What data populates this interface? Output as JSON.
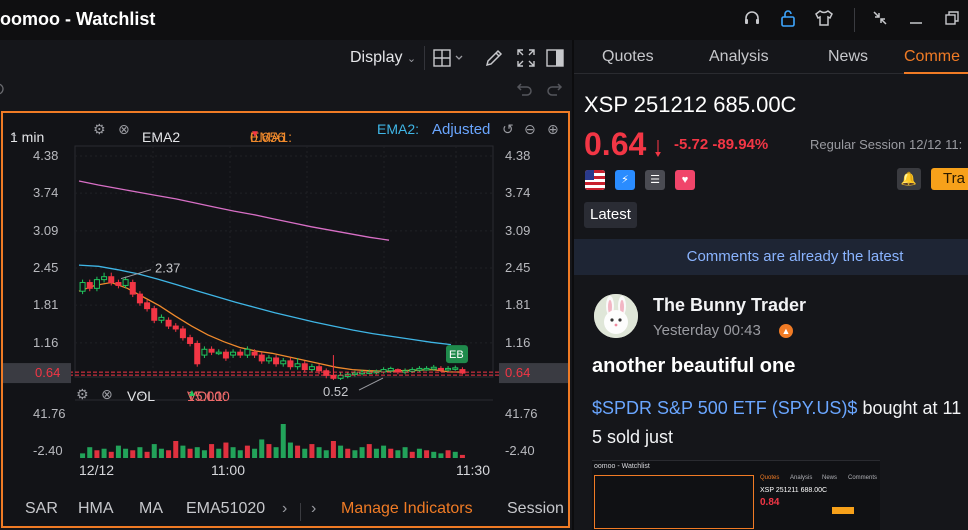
{
  "window": {
    "title": "oomoo - Watchlist",
    "icons": [
      "headset-icon",
      "lock-icon",
      "shirt-icon",
      "collapse-icon",
      "minimize-icon",
      "restore-icon"
    ]
  },
  "toolbar": {
    "display_label": "Display",
    "icons": [
      "layout-grid-icon",
      "pencil-icon",
      "fullscreen-icon",
      "panel-icon",
      "undo-icon",
      "redo-icon"
    ]
  },
  "chart_header": {
    "period": "1 min",
    "indicator": "EMA2",
    "ema1_label": "EMA1:",
    "ema1_value": "0.656",
    "ema2_label": "EMA2:",
    "ema2_value": "Adjusted"
  },
  "volume_header": {
    "indicator": "VOL",
    "vol1_label": "VOL1:",
    "vol1_value": "15.000"
  },
  "indicator_bar": {
    "items": [
      "SAR",
      "HMA",
      "MA",
      "EMA51020"
    ],
    "manage_label": "Manage Indicators",
    "session_label": "Session"
  },
  "chart_data": [
    {
      "type": "candlestick",
      "title": "",
      "y_ticks": [
        "4.38",
        "3.74",
        "3.09",
        "2.45",
        "1.81",
        "1.16",
        "0.64"
      ],
      "ylim": [
        0.3,
        4.5
      ],
      "x_ticks": [
        "12/12",
        "11:00",
        "11:30"
      ],
      "current_price": "0.64",
      "annotations": [
        "2.37",
        "0.52"
      ],
      "marker_label": "EB",
      "candles": [
        [
          2.05,
          2.2,
          2.25,
          2.0
        ],
        [
          2.2,
          2.1,
          2.25,
          2.05
        ],
        [
          2.1,
          2.25,
          2.3,
          2.05
        ],
        [
          2.25,
          2.3,
          2.37,
          2.2
        ],
        [
          2.3,
          2.2,
          2.37,
          2.15
        ],
        [
          2.2,
          2.15,
          2.25,
          2.1
        ],
        [
          2.15,
          2.25,
          2.3,
          2.1
        ],
        [
          2.2,
          2.0,
          2.25,
          1.95
        ],
        [
          2.0,
          1.85,
          2.05,
          1.8
        ],
        [
          1.85,
          1.75,
          1.9,
          1.7
        ],
        [
          1.75,
          1.55,
          1.8,
          1.5
        ],
        [
          1.55,
          1.6,
          1.65,
          1.5
        ],
        [
          1.55,
          1.45,
          1.6,
          1.4
        ],
        [
          1.45,
          1.4,
          1.5,
          1.35
        ],
        [
          1.4,
          1.25,
          1.45,
          1.2
        ],
        [
          1.25,
          1.15,
          1.3,
          1.1
        ],
        [
          1.15,
          0.8,
          1.2,
          0.75
        ],
        [
          0.95,
          1.05,
          1.1,
          0.9
        ],
        [
          1.05,
          1.0,
          1.1,
          0.95
        ],
        [
          1.0,
          1.0,
          1.05,
          0.95
        ],
        [
          1.0,
          0.9,
          1.05,
          0.85
        ],
        [
          0.95,
          1.0,
          1.05,
          0.9
        ],
        [
          1.0,
          0.95,
          1.05,
          0.9
        ],
        [
          0.95,
          1.05,
          1.1,
          0.9
        ],
        [
          1.0,
          0.95,
          1.05,
          0.9
        ],
        [
          0.95,
          0.85,
          1.0,
          0.8
        ],
        [
          0.85,
          0.9,
          0.95,
          0.8
        ],
        [
          0.9,
          0.8,
          0.95,
          0.75
        ],
        [
          0.8,
          0.85,
          0.9,
          0.75
        ],
        [
          0.85,
          0.75,
          0.9,
          0.7
        ],
        [
          0.75,
          0.8,
          0.9,
          0.7
        ],
        [
          0.8,
          0.7,
          0.85,
          0.65
        ],
        [
          0.7,
          0.75,
          0.8,
          0.65
        ],
        [
          0.75,
          0.68,
          0.8,
          0.62
        ],
        [
          0.68,
          0.6,
          0.72,
          0.55
        ],
        [
          0.6,
          0.55,
          0.95,
          0.52
        ],
        [
          0.55,
          0.6,
          0.65,
          0.52
        ],
        [
          0.58,
          0.62,
          0.66,
          0.55
        ],
        [
          0.62,
          0.64,
          0.68,
          0.58
        ],
        [
          0.63,
          0.66,
          0.7,
          0.6
        ],
        [
          0.64,
          0.66,
          0.7,
          0.62
        ],
        [
          0.65,
          0.67,
          0.7,
          0.62
        ],
        [
          0.66,
          0.7,
          0.74,
          0.63
        ],
        [
          0.68,
          0.72,
          0.75,
          0.64
        ],
        [
          0.7,
          0.66,
          0.72,
          0.62
        ],
        [
          0.66,
          0.68,
          0.72,
          0.62
        ],
        [
          0.67,
          0.7,
          0.74,
          0.64
        ],
        [
          0.69,
          0.72,
          0.76,
          0.66
        ],
        [
          0.7,
          0.72,
          0.76,
          0.68
        ],
        [
          0.71,
          0.74,
          0.78,
          0.68
        ],
        [
          0.72,
          0.7,
          0.76,
          0.66
        ],
        [
          0.7,
          0.72,
          0.76,
          0.66
        ],
        [
          0.71,
          0.73,
          0.77,
          0.68
        ],
        [
          0.7,
          0.64,
          0.74,
          0.62
        ]
      ],
      "series": [
        {
          "name": "EMA1",
          "color": "#f08a2c",
          "values": [
            2.05,
            2.15,
            2.2,
            2.1,
            1.95,
            1.8,
            1.62,
            1.45,
            1.3,
            1.18,
            1.08,
            1.02,
            0.98,
            0.92,
            0.86,
            0.8,
            0.74,
            0.7,
            0.68,
            0.67,
            0.68,
            0.69,
            0.7,
            0.66,
            0.656
          ]
        },
        {
          "name": "EMA2",
          "color": "#3fb6e6",
          "values": [
            2.5,
            2.48,
            2.42,
            2.35,
            2.26,
            2.16,
            2.06,
            1.96,
            1.86,
            1.77,
            1.68,
            1.6,
            1.52,
            1.45,
            1.38,
            1.32,
            1.27,
            1.22,
            1.17,
            1.13
          ]
        },
        {
          "name": "MA",
          "color": "#d86fc6",
          "values": [
            3.95,
            3.88,
            3.82,
            3.76,
            3.7,
            3.64,
            3.57,
            3.5,
            3.43,
            3.37,
            3.3,
            3.23,
            3.16,
            3.1,
            3.04,
            2.98,
            2.93
          ]
        }
      ]
    },
    {
      "type": "bar",
      "title": "",
      "y_ticks": [
        "41.76",
        "-2.40"
      ],
      "ylim": [
        -2.4,
        41.76
      ],
      "values": [
        3,
        7,
        5,
        6,
        4,
        8,
        6,
        5,
        7,
        4,
        9,
        6,
        5,
        11,
        8,
        6,
        7,
        5,
        9,
        6,
        10,
        7,
        5,
        8,
        6,
        12,
        9,
        7,
        22,
        10,
        8,
        6,
        9,
        7,
        5,
        11,
        8,
        6,
        5,
        7,
        9,
        6,
        8,
        6,
        5,
        7,
        4,
        6,
        5,
        4,
        3,
        5,
        4,
        2
      ],
      "colors": [
        "g",
        "g",
        "r",
        "g",
        "r",
        "g",
        "g",
        "r",
        "g",
        "r",
        "g",
        "g",
        "r",
        "r",
        "g",
        "r",
        "g",
        "g",
        "r",
        "g",
        "r",
        "g",
        "g",
        "r",
        "g",
        "g",
        "r",
        "g",
        "g",
        "g",
        "r",
        "g",
        "r",
        "g",
        "g",
        "r",
        "g",
        "r",
        "g",
        "g",
        "r",
        "g",
        "g",
        "r",
        "g",
        "g",
        "r",
        "g",
        "r",
        "g",
        "g",
        "r",
        "g",
        "r"
      ]
    }
  ],
  "right_panel": {
    "tabs": [
      "Quotes",
      "Analysis",
      "News",
      "Comme"
    ],
    "active_tab": 3,
    "symbol": "XSP 251212 685.00C",
    "price": "0.64",
    "change": "-5.72 -89.94%",
    "session": "Regular Session 12/12 11:",
    "trade_label": "Tra",
    "latest_label": "Latest",
    "latest_banner": "Comments are already the latest",
    "colors": {
      "down": "#f23645",
      "up": "#22c55e",
      "accent": "#f07b25",
      "trade": "#f7a11a"
    }
  },
  "post": {
    "author": "The Bunny Trader",
    "time": "Yesterday 00:43",
    "title": "another beautiful one",
    "tag": "$SPDR S&P 500 ETF (SPY.US)$",
    "body_rest": " bought at 11",
    "body_line2": "5 sold just",
    "thumb": {
      "title": "oomoo - Watchlist",
      "symbol": "XSP 251211 688.00C",
      "price": "0.84",
      "tabs": [
        "Quotes",
        "Analysis",
        "News",
        "Comments"
      ]
    }
  }
}
